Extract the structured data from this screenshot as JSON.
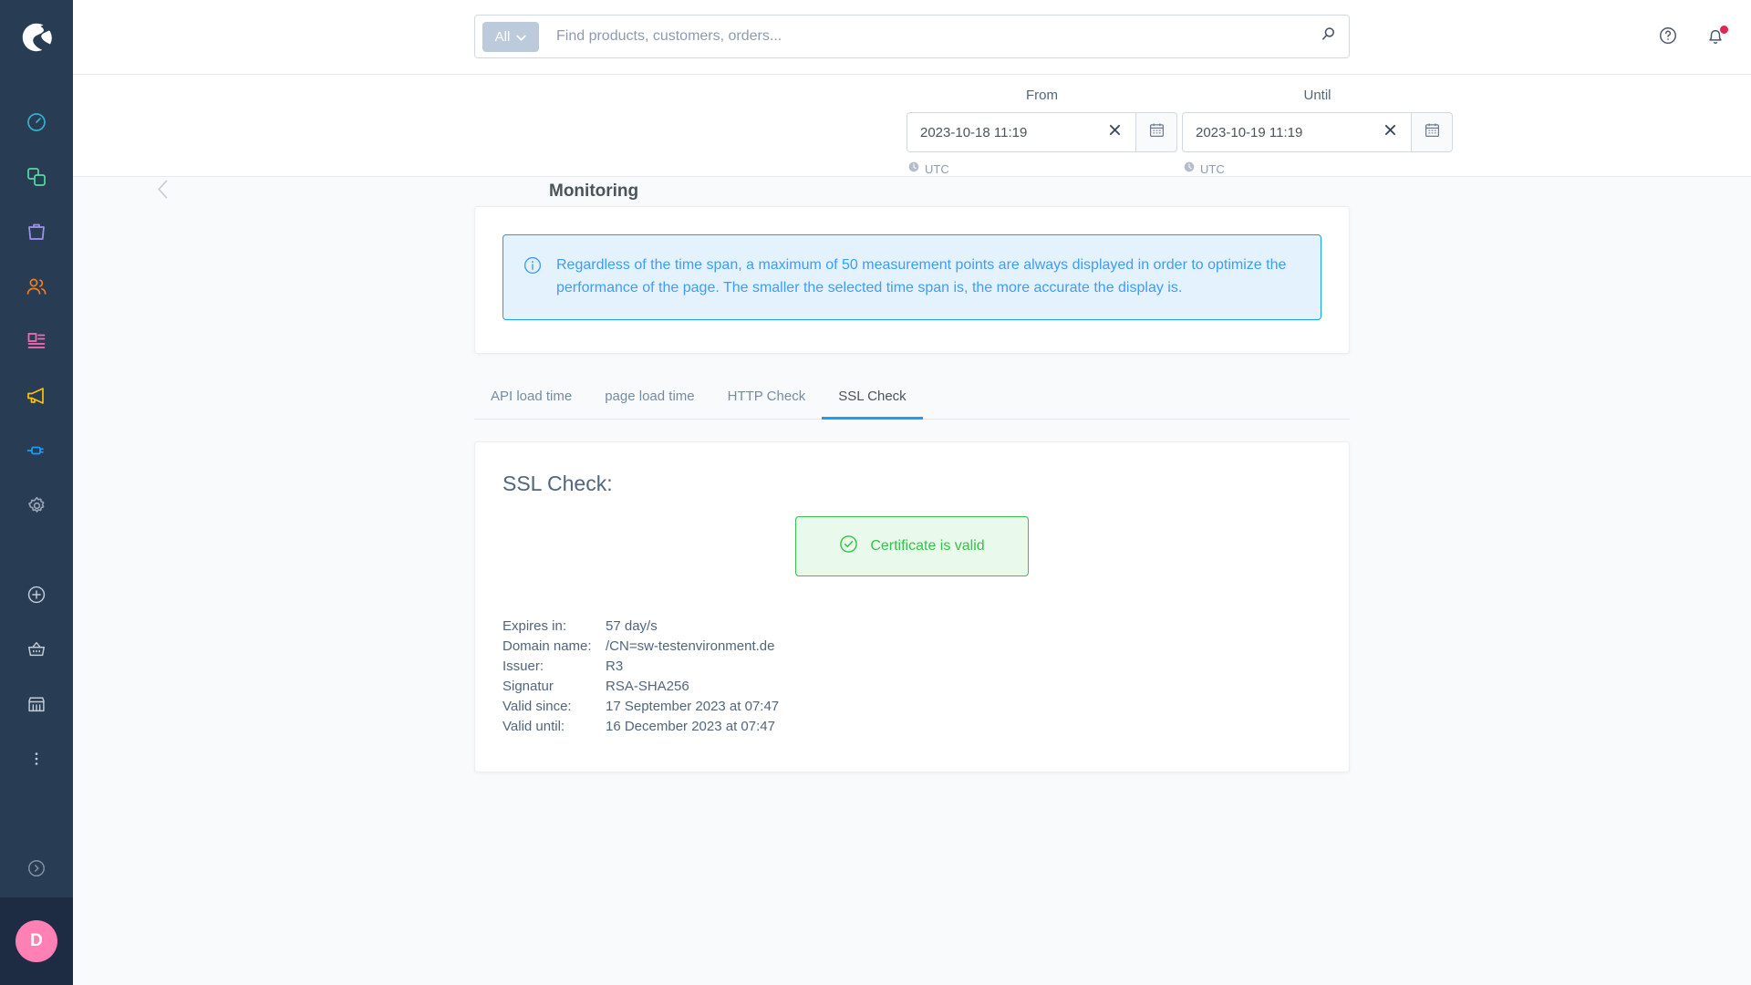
{
  "sidebar": {
    "logo": "shopware-logo",
    "items": [
      {
        "name": "dashboard",
        "icon": "gauge-icon",
        "color": "#37afce"
      },
      {
        "name": "catalogues",
        "icon": "copy-icon",
        "color": "#57d9a3"
      },
      {
        "name": "orders",
        "icon": "shopping-bag-icon",
        "color": "#a092f0"
      },
      {
        "name": "customers",
        "icon": "users-icon",
        "color": "#ef7e21"
      },
      {
        "name": "content",
        "icon": "content-icon",
        "color": "#ff68b4"
      },
      {
        "name": "marketing",
        "icon": "megaphone-icon",
        "color": "#fcc202"
      },
      {
        "name": "extensions",
        "icon": "plug-icon",
        "color": "#189eff"
      },
      {
        "name": "settings",
        "icon": "gear-icon",
        "color": "#9aa5b5"
      }
    ],
    "quick_items": [
      {
        "name": "add",
        "icon": "plus-circle-icon"
      },
      {
        "name": "basket",
        "icon": "basket-icon"
      },
      {
        "name": "store",
        "icon": "storefront-icon"
      },
      {
        "name": "more",
        "icon": "kebab-menu-icon"
      }
    ],
    "expand": {
      "icon": "chevron-right-circle-icon"
    },
    "user_avatar_initial": "D"
  },
  "topbar": {
    "search": {
      "scope_label": "All",
      "scope_chevron": "chevron-down-icon",
      "placeholder": "Find products, customers, orders...",
      "value": "",
      "search_icon": "search-icon"
    },
    "help_icon": "question-circle-icon",
    "notifications_icon": "bell-icon",
    "has_notification": true
  },
  "smartbar": {
    "back_icon": "chevron-left-icon",
    "title": "Monitoring",
    "date_from": {
      "label": "From",
      "value": "2023-10-18 11:19",
      "clear_icon": "close-icon",
      "calendar_icon": "calendar-icon",
      "timezone": "UTC",
      "timezone_icon": "clock-icon"
    },
    "date_until": {
      "label": "Until",
      "value": "2023-10-19 11:19",
      "clear_icon": "close-icon",
      "calendar_icon": "calendar-icon",
      "timezone": "UTC",
      "timezone_icon": "clock-icon"
    }
  },
  "alert": {
    "icon": "info-circle-icon",
    "text": "Regardless of the time span, a maximum of 50 measurement points are always displayed in order to optimize the performance of the page. The smaller the selected time span is, the more accurate the display is."
  },
  "tabs": [
    {
      "label": "API load time",
      "active": false
    },
    {
      "label": "page load time",
      "active": false
    },
    {
      "label": "HTTP Check",
      "active": false
    },
    {
      "label": "SSL Check",
      "active": true
    }
  ],
  "ssl": {
    "title": "SSL Check:",
    "status": {
      "icon": "check-circle-icon",
      "text": "Certificate is valid",
      "color": "#37c24c",
      "background": "#e9f9ec"
    },
    "details": [
      {
        "key": "Expires in:",
        "value": "57 day/s"
      },
      {
        "key": "Domain name:",
        "value": "/CN=sw-testenvironment.de"
      },
      {
        "key": "Issuer:",
        "value": "R3"
      },
      {
        "key": "Signatur",
        "value": "RSA-SHA256"
      },
      {
        "key": "Valid since:",
        "value": "17 September 2023 at 07:47"
      },
      {
        "key": "Valid until:",
        "value": "16 December 2023 at 07:47"
      }
    ]
  },
  "colors": {
    "sidebar_bg": "#283c54",
    "sidebar_user_bg": "#1d2b43",
    "accent_blue": "#189eff",
    "page_bg": "#f9fafb",
    "text_dark": "#4a545b",
    "text_muted": "#758ca3"
  }
}
